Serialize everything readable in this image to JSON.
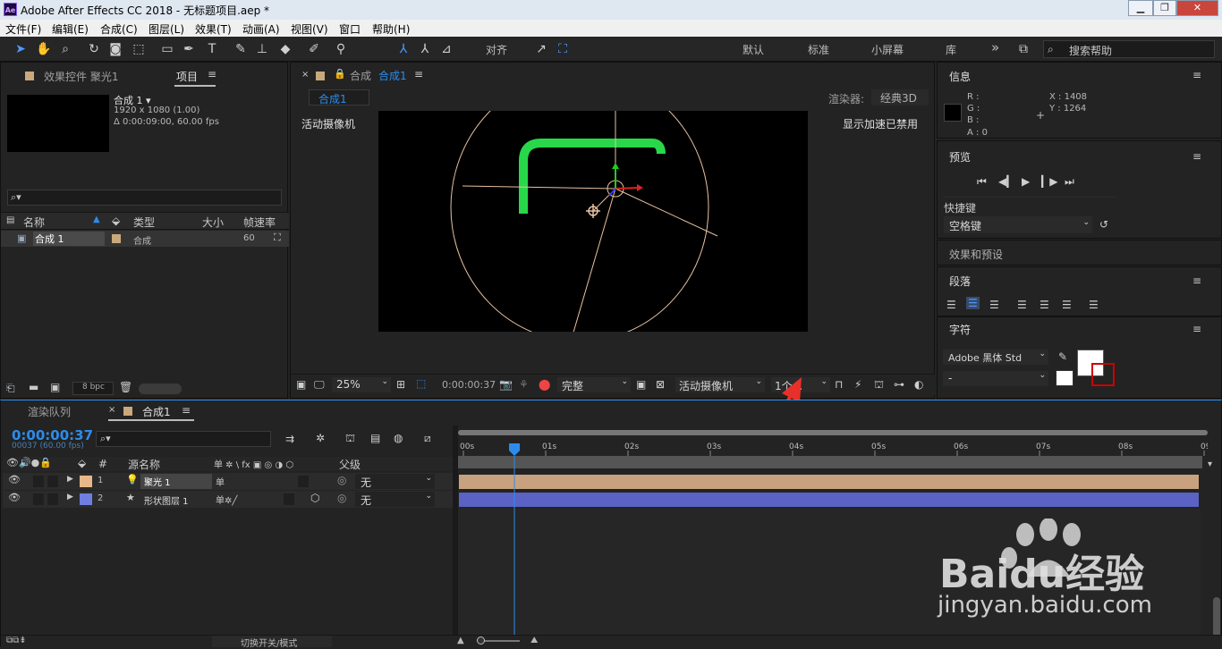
{
  "window": {
    "title": "Adobe After Effects CC 2018 - 无标题项目.aep *",
    "logo": "Ae",
    "controls": [
      "minimize-icon",
      "restore-icon",
      "close-icon"
    ]
  },
  "menu": [
    "文件(F)",
    "编辑(E)",
    "合成(C)",
    "图层(L)",
    "效果(T)",
    "动画(A)",
    "视图(V)",
    "窗口",
    "帮助(H)"
  ],
  "toolbar": {
    "align_label": "对齐",
    "workspaces": [
      "默认",
      "标准",
      "小屏幕",
      "库"
    ],
    "more": "»",
    "search_placeholder": "搜索帮助"
  },
  "project_panel": {
    "tab_effects": "效果控件 聚光1",
    "tab_project": "项目",
    "comp_name": "合成 1 ▾",
    "comp_res": "1920 x 1080 (1.00)",
    "comp_duration": "Δ 0:00:09:00, 60.00 fps",
    "search_icon": "⌕▾",
    "columns": [
      "名称",
      "类型",
      "大小",
      "帧速率"
    ],
    "items": [
      {
        "name": "合成 1",
        "type": "合成",
        "size": "",
        "fps": "60"
      }
    ],
    "bpc": "8 bpc"
  },
  "comp_panel": {
    "tab_label": "合成",
    "tab_comp": "合成1",
    "sub_tab": "合成1",
    "renderer_label": "渲染器:",
    "renderer_value": "经典3D",
    "camera_label": "活动摄像机",
    "accel_label": "显示加速已禁用",
    "zoom": "25%",
    "timecode": "0:00:00:37",
    "quality": "完整",
    "camera_select": "活动摄像机",
    "views_select": "1个..."
  },
  "info_panel": {
    "title": "信息",
    "r": "R :",
    "g": "G :",
    "b": "B :",
    "a": "A : 0",
    "x": "X : 1408",
    "y": "Y : 1264"
  },
  "preview_panel": {
    "title": "预览",
    "shortcut_label": "快捷键",
    "shortcut_value": "空格键"
  },
  "effects_presets": {
    "title": "效果和预设"
  },
  "paragraph_panel": {
    "title": "段落"
  },
  "character_panel": {
    "title": "字符",
    "font": "Adobe 黑体 Std",
    "style": "-"
  },
  "timeline": {
    "tab_render": "渲染队列",
    "tab_comp": "合成1",
    "timecode": "0:00:00:37",
    "timecode_sub": "00037 (60.00 fps)",
    "columns": {
      "num": "#",
      "source": "源名称",
      "switches": "单 ✲ \\ fx ▣ ◎ ◑ ⬡",
      "parent": "父级"
    },
    "layers": [
      {
        "num": "1",
        "name": "聚光 1",
        "parent": "无",
        "color": "#e8b88b"
      },
      {
        "num": "2",
        "name": "形状图层 1",
        "parent": "无",
        "color": "#6f7ee0"
      }
    ],
    "ruler": [
      "00s",
      "01s",
      "02s",
      "03s",
      "04s",
      "05s",
      "06s",
      "07s",
      "08s",
      "09s"
    ],
    "playhead_seconds": 0.62,
    "footer_label": "切换开关/模式"
  },
  "watermark": {
    "brand": "Baidu经验",
    "url": "jingyan.baidu.com"
  }
}
